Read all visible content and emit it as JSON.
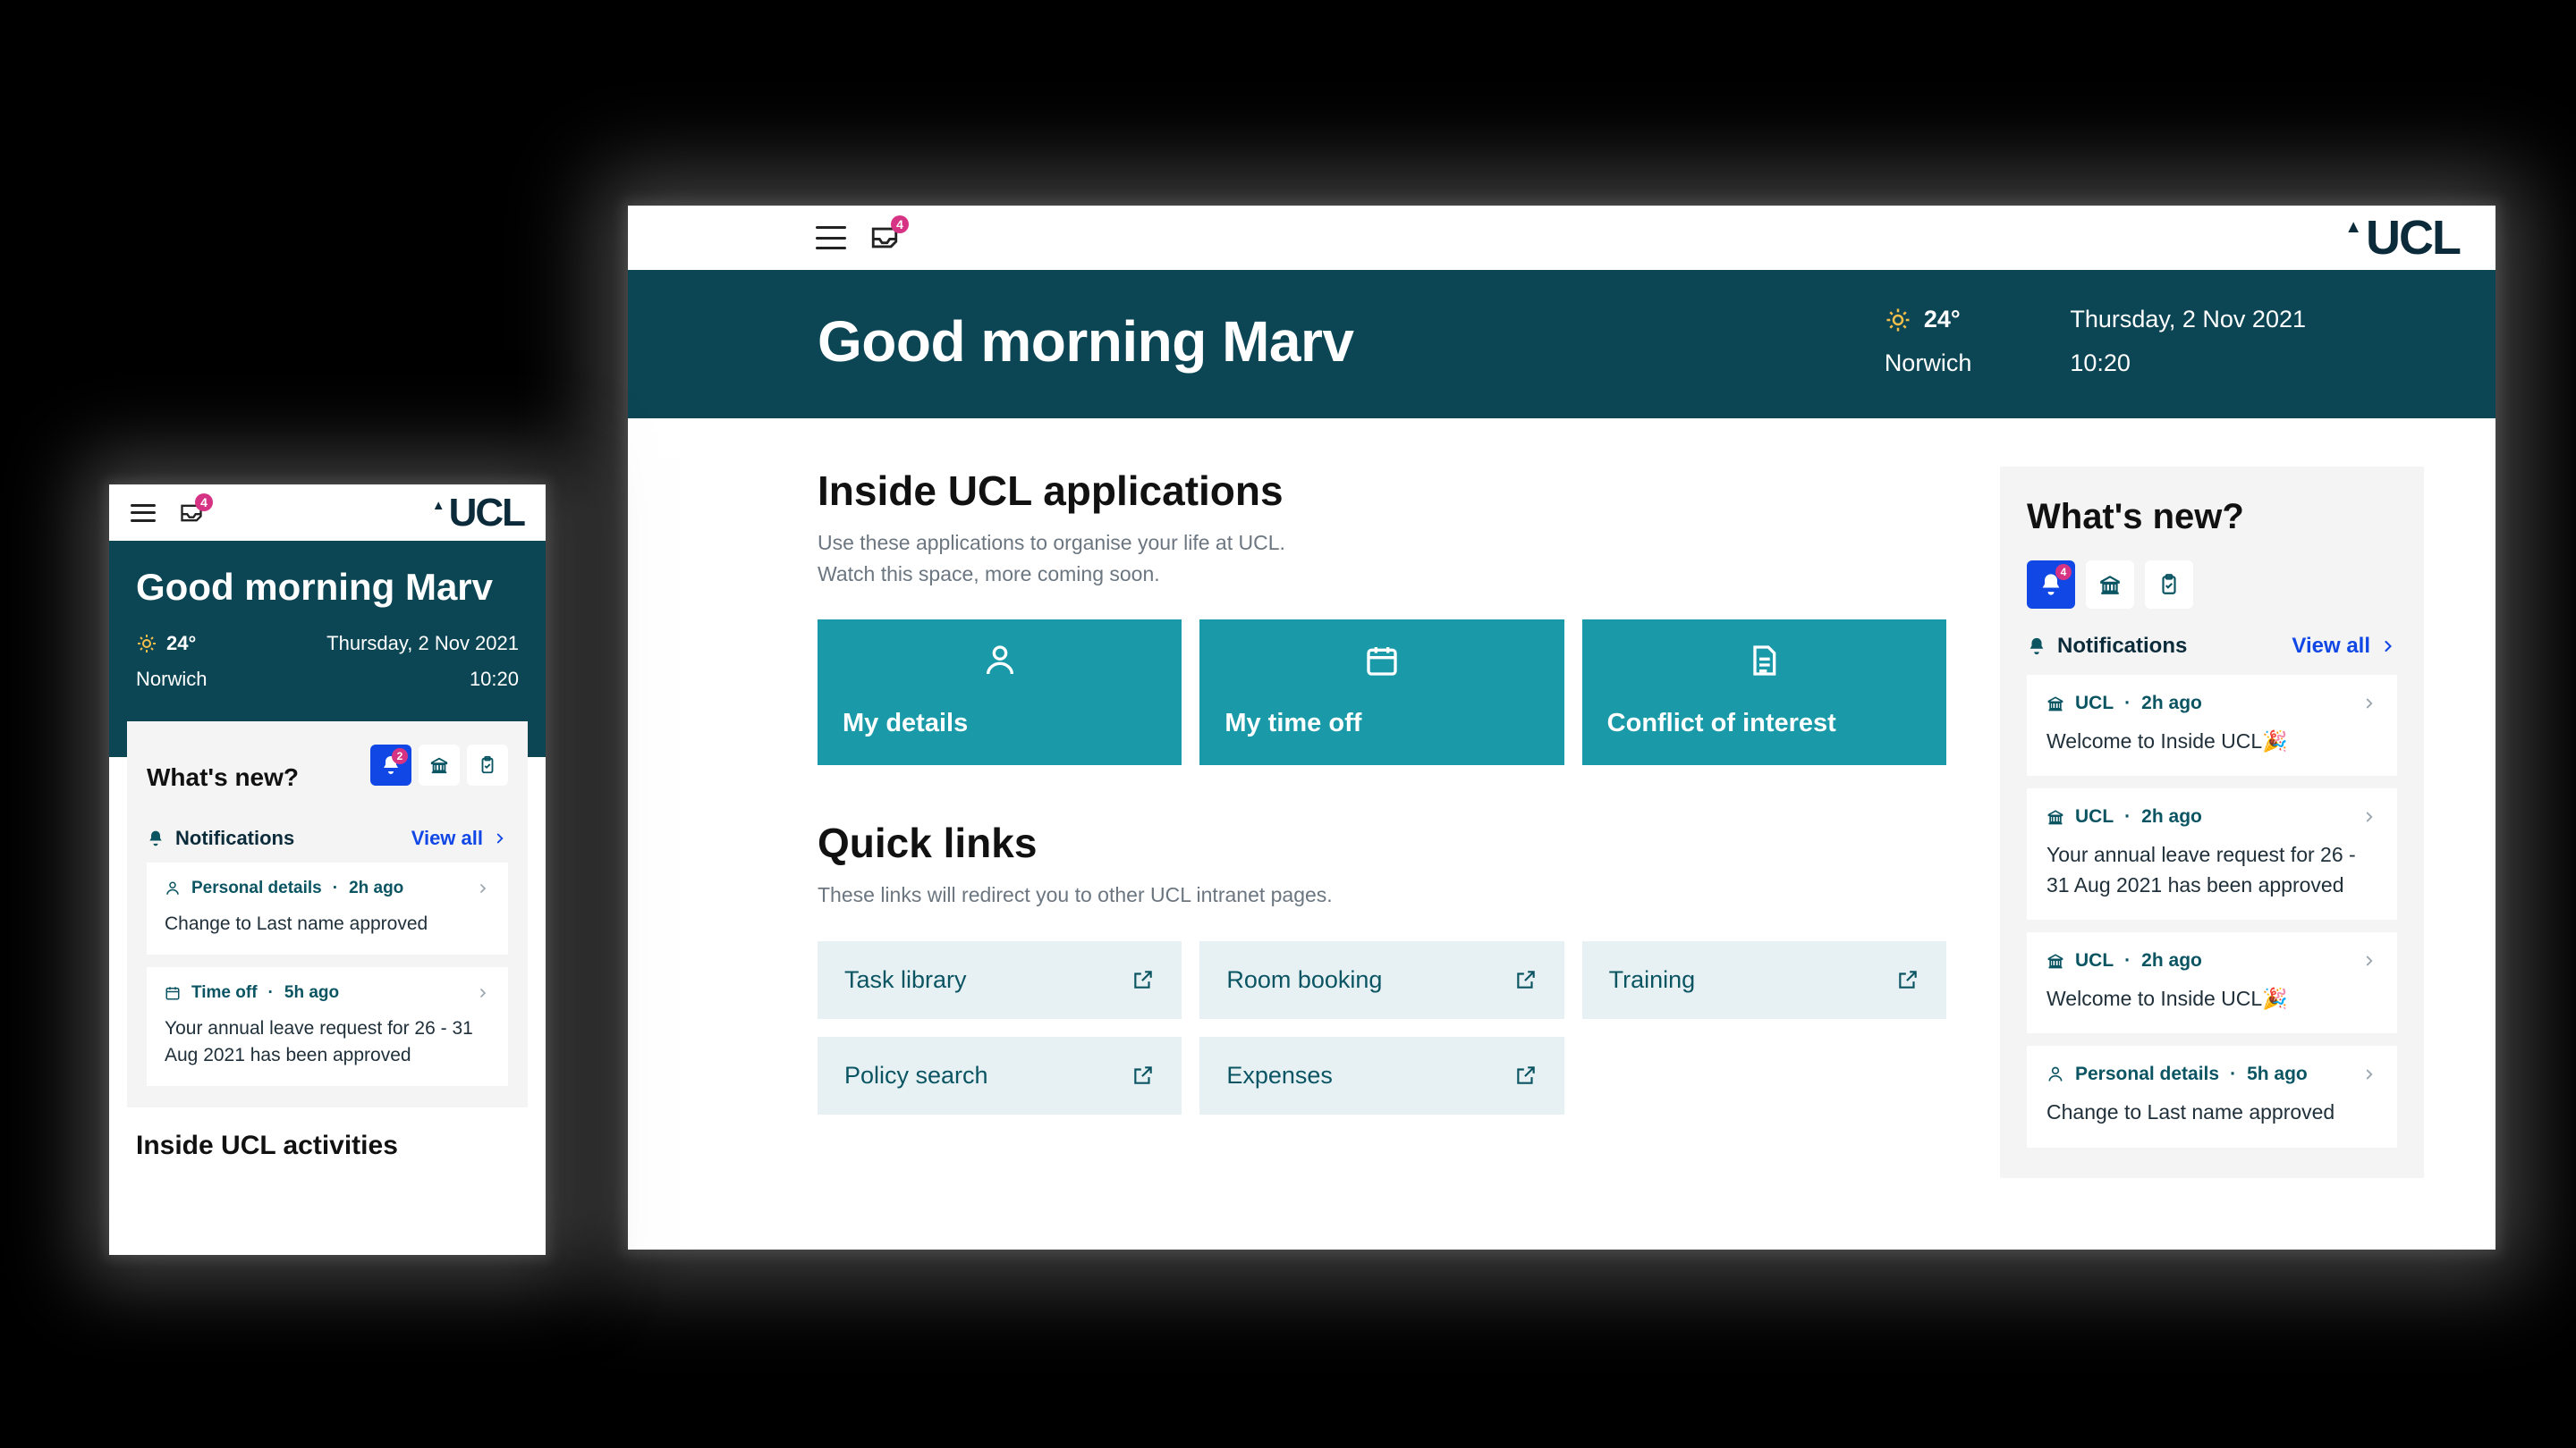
{
  "brand": {
    "name": "UCL",
    "mark": "▲"
  },
  "badges": {
    "inbox": "4",
    "notifications": "4",
    "mobile_notifications": "2"
  },
  "hero": {
    "greeting": "Good morning Marv",
    "temperature": "24°",
    "location": "Norwich",
    "date": "Thursday, 2 Nov 2021",
    "time": "10:20"
  },
  "apps": {
    "heading": "Inside UCL applications",
    "subtitle": "Use these applications to organise your life at UCL.\nWatch this space, more coming soon.",
    "tiles": [
      {
        "icon": "person",
        "label": "My details"
      },
      {
        "icon": "calendar",
        "label": "My time off"
      },
      {
        "icon": "document",
        "label": "Conflict of interest"
      }
    ]
  },
  "quicklinks": {
    "heading": "Quick links",
    "subtitle": "These links will redirect you to other UCL intranet pages.",
    "items": [
      "Task library",
      "Room booking",
      "Training",
      "Policy search",
      "Expenses"
    ]
  },
  "whatsnew": {
    "heading": "What's new?",
    "tabs": [
      "bell",
      "institution",
      "clipboard-check"
    ],
    "notifications_label": "Notifications",
    "view_all": "View all",
    "cards": [
      {
        "icon": "institution",
        "source": "UCL",
        "time": "2h ago",
        "msg": "Welcome to Inside UCL🎉"
      },
      {
        "icon": "institution",
        "source": "UCL",
        "time": "2h ago",
        "msg": "Your annual leave request for 26 - 31 Aug 2021 has been approved"
      },
      {
        "icon": "institution",
        "source": "UCL",
        "time": "2h ago",
        "msg": "Welcome to Inside UCL🎉"
      },
      {
        "icon": "person",
        "source": "Personal details",
        "time": "5h ago",
        "msg": "Change to Last name approved"
      }
    ]
  },
  "mobile": {
    "panel_heading": "What's new?",
    "cards": [
      {
        "icon": "person",
        "source": "Personal details",
        "time": "2h ago",
        "msg": "Change to Last name approved"
      },
      {
        "icon": "calendar",
        "source": "Time off",
        "time": "5h ago",
        "msg": "Your annual leave request for 26 - 31 Aug 2021 has been approved"
      }
    ],
    "activities_heading": "Inside UCL activities"
  }
}
